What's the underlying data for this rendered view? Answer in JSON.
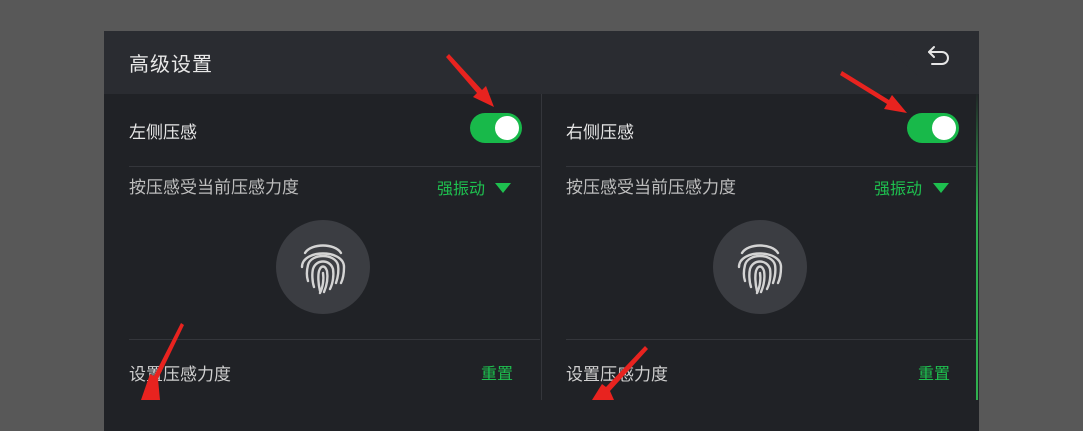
{
  "header": {
    "title": "高级设置",
    "back_icon": "back-arrow-icon"
  },
  "left": {
    "toggle_label": "左侧压感",
    "toggle_on": true,
    "vibration_label": "按压感受当前压感力度",
    "vibration_value": "强振动",
    "fingerprint_icon": "fingerprint-icon",
    "set_label": "设置压感力度",
    "reset_label": "重置"
  },
  "right": {
    "toggle_label": "右侧压感",
    "toggle_on": true,
    "vibration_label": "按压感受当前压感力度",
    "vibration_value": "强振动",
    "fingerprint_icon": "fingerprint-icon",
    "set_label": "设置压感力度",
    "reset_label": "重置"
  },
  "colors": {
    "accent": "#18b94a",
    "panel": "#202226",
    "header": "#2a2c31",
    "annotation": "#e8231f"
  }
}
